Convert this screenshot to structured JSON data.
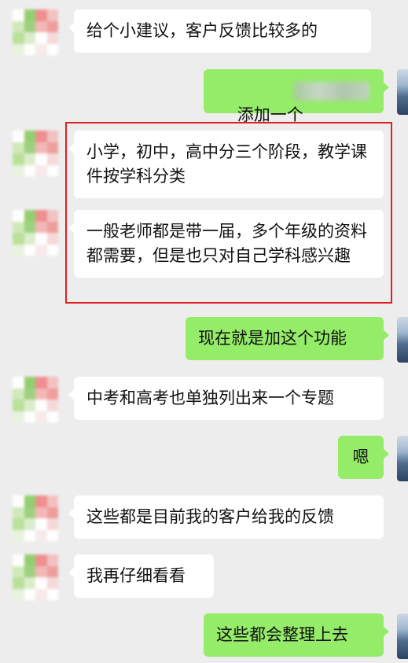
{
  "colors": {
    "background": "#ededed",
    "incoming_bubble": "#ffffff",
    "outgoing_bubble": "#95ec69",
    "highlight_border": "#e02020"
  },
  "messages": [
    {
      "side": "in",
      "text": "给个小建议，客户反馈比较多的"
    },
    {
      "side": "out",
      "text": "添加一个"
    },
    {
      "side": "in",
      "text": "小学，初中，高中分三个阶段，教学课件按学科分类"
    },
    {
      "side": "in",
      "text": "一般老师都是带一届，多个年级的资料都需要，但是也只对自己学科感兴趣"
    },
    {
      "side": "out",
      "text": "现在就是加这个功能"
    },
    {
      "side": "in",
      "text": "中考和高考也单独列出来一个专题"
    },
    {
      "side": "out",
      "text": "嗯"
    },
    {
      "side": "in",
      "text": "这些都是目前我的客户给我的反馈"
    },
    {
      "side": "in",
      "text": "我再仔细看看"
    },
    {
      "side": "out",
      "text": "这些都会整理上去"
    }
  ]
}
